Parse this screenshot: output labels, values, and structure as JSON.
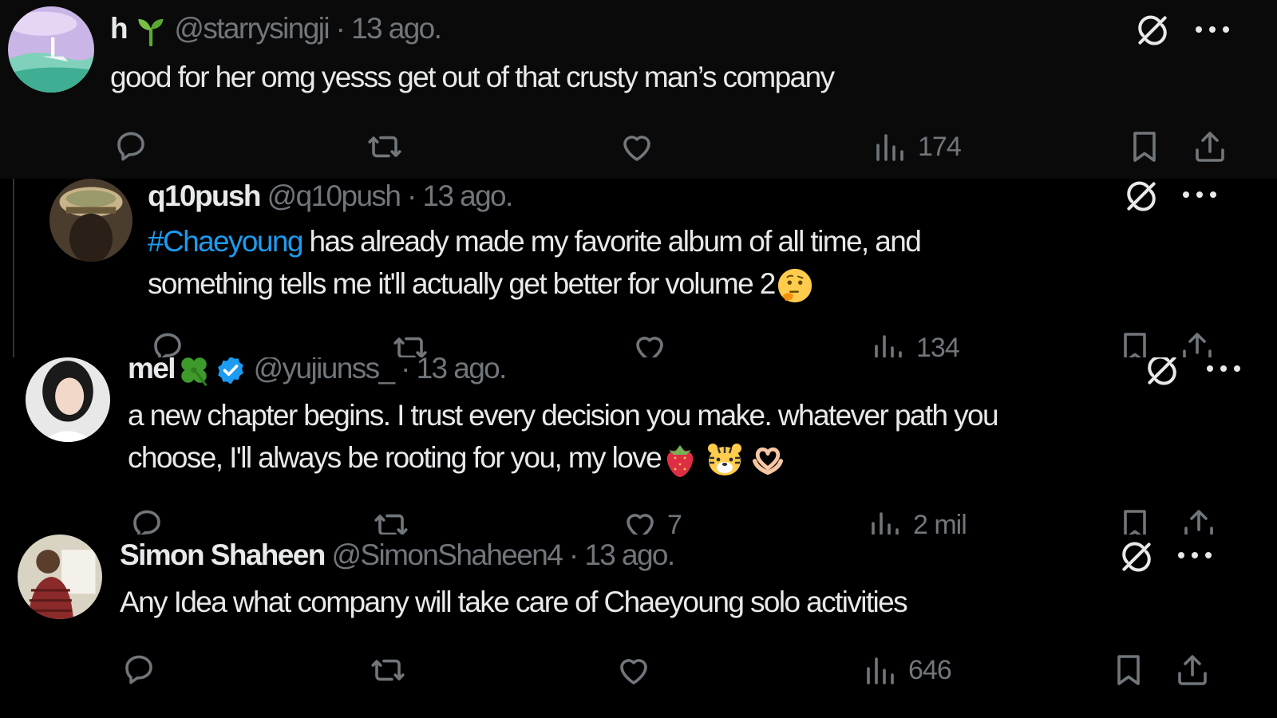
{
  "colors": {
    "background": "#000000",
    "text": "#e7e9ea",
    "muted": "#71767b",
    "link": "#1d9bf0",
    "verified": "#1d9bf0"
  },
  "tweets": [
    {
      "name": "h",
      "name_emoji": "seedling-icon",
      "handle": "@starrysingji",
      "separator": "·",
      "time": "13 ago.",
      "text": "good for her omg yesss get out of that crusty man’s company",
      "views": "174"
    },
    {
      "name": "q10push",
      "handle": "@q10push",
      "separator": "·",
      "time": "13 ago.",
      "hashtag": "#Chaeyoung",
      "text_line1": " has already made my favorite album of all time, and",
      "text_line2": "something tells me it'll actually get better for volume 2",
      "text_emojis": [
        "thinking-face-icon"
      ],
      "views": "134"
    },
    {
      "name": "mel",
      "name_emoji": "four-leaf-clover-icon",
      "verified": true,
      "handle": "@yujiunss_",
      "separator": "·",
      "time": "13 ago.",
      "text_line1": "a new chapter begins. I trust every decision you make. whatever path you",
      "text_line2": "choose, I'll always be rooting for you, my love",
      "text_emojis": [
        "strawberry-icon",
        "tiger-face-icon",
        "heart-hands-icon"
      ],
      "likes": "7",
      "views": "2 mil"
    },
    {
      "name": "Simon Shaheen",
      "handle": "@SimonShaheen4",
      "separator": "·",
      "time": "13 ago.",
      "text": "Any Idea what company will take care of Chaeyoung solo activities",
      "views": "646"
    }
  ]
}
